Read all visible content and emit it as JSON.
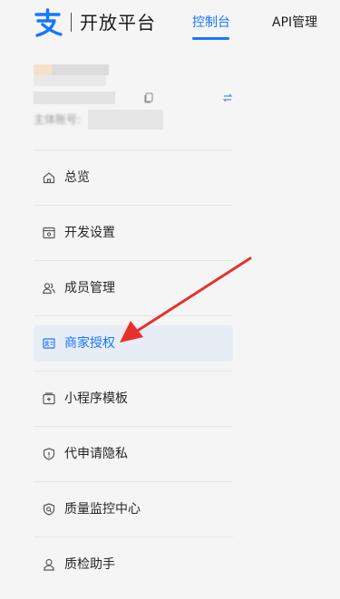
{
  "header": {
    "brand": "开放平台",
    "tabs": [
      {
        "label": "控制台",
        "active": true
      },
      {
        "label": "API管理",
        "active": false
      }
    ]
  },
  "account": {
    "label": "主体账号:"
  },
  "menu": {
    "items": [
      {
        "label": "总览",
        "icon": "home-icon"
      },
      {
        "label": "开发设置",
        "icon": "dev-settings-icon"
      },
      {
        "label": "成员管理",
        "icon": "members-icon"
      },
      {
        "label": "商家授权",
        "icon": "merchant-auth-icon",
        "active": true
      },
      {
        "label": "小程序模板",
        "icon": "template-icon"
      },
      {
        "label": "代申请隐私",
        "icon": "privacy-shield-icon"
      },
      {
        "label": "质量监控中心",
        "icon": "quality-monitor-icon"
      },
      {
        "label": "质检助手",
        "icon": "user-icon"
      }
    ]
  },
  "colors": {
    "accent": "#1677ff",
    "brand_logo": "#1677ff",
    "annotation_arrow": "#e8302a",
    "active_item_bg": "#e8edf5"
  }
}
